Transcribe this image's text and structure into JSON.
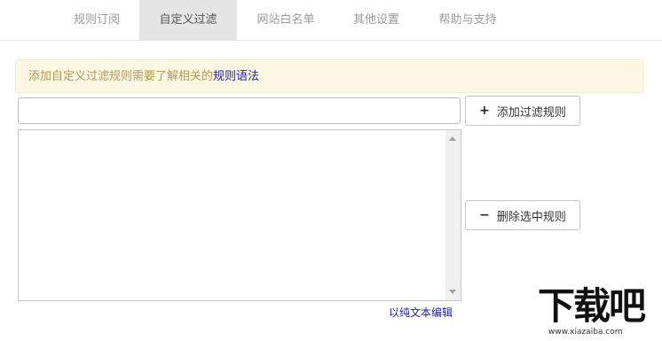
{
  "tabs": [
    {
      "label": "规则订阅",
      "active": false
    },
    {
      "label": "自定义过滤",
      "active": true
    },
    {
      "label": "网站白名单",
      "active": false
    },
    {
      "label": "其他设置",
      "active": false
    },
    {
      "label": "帮助与支持",
      "active": false
    }
  ],
  "notice": {
    "text": "添加自定义过滤规则需要了解相关的",
    "link": "规则语法"
  },
  "rule_input": {
    "value": "",
    "placeholder": ""
  },
  "buttons": {
    "add": {
      "icon": "plus-icon",
      "glyph": "+",
      "label": "添加过滤规则"
    },
    "delete": {
      "icon": "minus-icon",
      "glyph": "−",
      "label": "删除选中规则"
    }
  },
  "rules_list": {
    "items": []
  },
  "edit_link": "以纯文本编辑",
  "watermark": {
    "text": "下载吧",
    "url": "www.xiazaiba.com"
  },
  "colors": {
    "active_tab_bg": "#e5e5e5",
    "notice_bg": "#fcf8e3",
    "notice_text": "#b79858",
    "link": "#1d1da8"
  }
}
